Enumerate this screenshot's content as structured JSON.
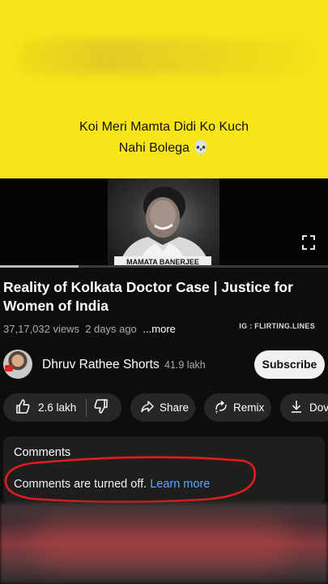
{
  "overlay": {
    "caption_line1": "Koi Meri Mamta Didi Ko Kuch",
    "caption_line2": "Nahi Bolega",
    "caption_emoji": "💀",
    "band_color": "#f7e51a"
  },
  "video": {
    "name_tag": "MAMATA BANERJEE",
    "progress": 0.24
  },
  "details": {
    "title": "Reality of Kolkata Doctor Case | Justice for Women of India",
    "views": "37,17,032 views",
    "age": "2 days ago",
    "more_label": "...more",
    "ig_tag": "IG : FLIRTING.LINES"
  },
  "channel": {
    "name": "Dhruv Rathee Shorts",
    "subscribers": "41.9 lakh",
    "subscribe_label": "Subscribe"
  },
  "actions": {
    "likes": "2.6 lakh",
    "share_label": "Share",
    "remix_label": "Remix",
    "download_label": "Dov"
  },
  "comments": {
    "heading": "Comments",
    "status_text": "Comments are turned off.",
    "learn_more_label": "Learn more",
    "link_color": "#5ba8ff",
    "annotation_color": "#e01c1c"
  },
  "icons": [
    "fullscreen-icon",
    "thumbs-up-icon",
    "thumbs-down-icon",
    "share-icon",
    "remix-icon",
    "download-icon"
  ]
}
